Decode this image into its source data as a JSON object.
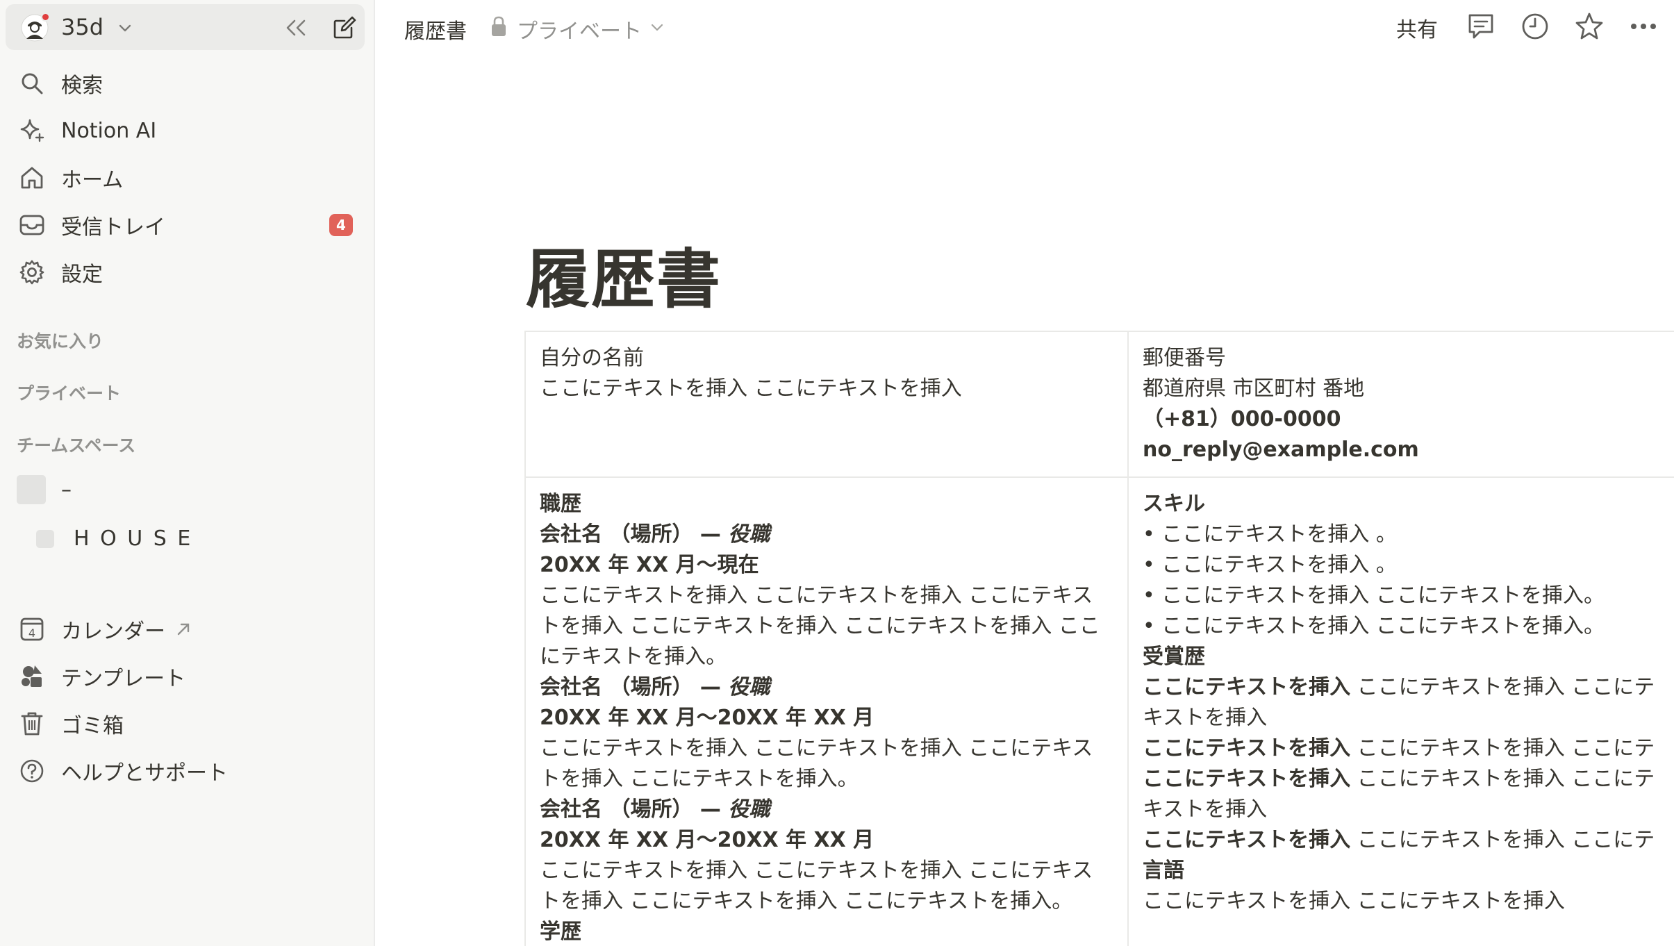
{
  "workspace": {
    "name": "35d"
  },
  "sidebar": {
    "nav": [
      {
        "label": "検索",
        "icon": "search-icon"
      },
      {
        "label": "Notion AI",
        "icon": "sparkle-icon"
      },
      {
        "label": "ホーム",
        "icon": "home-icon"
      },
      {
        "label": "受信トレイ",
        "icon": "inbox-icon",
        "badge": "4"
      },
      {
        "label": "設定",
        "icon": "gear-icon"
      }
    ],
    "sections": {
      "favorites": "お気に入り",
      "private": "プライベート",
      "teamspace": "チームスペース"
    },
    "teamspace_items": [
      {
        "label": "–"
      },
      {
        "label": "H O U S E"
      }
    ],
    "bottom": [
      {
        "label": "カレンダー",
        "icon": "calendar-icon",
        "calendar_day": "4"
      },
      {
        "label": "テンプレート",
        "icon": "templates-icon"
      },
      {
        "label": "ゴミ箱",
        "icon": "trash-icon"
      },
      {
        "label": "ヘルプとサポート",
        "icon": "help-icon"
      }
    ]
  },
  "topbar": {
    "page_title": "履歴書",
    "privacy": "プライベート",
    "share": "共有"
  },
  "page": {
    "title": "履歴書",
    "table": {
      "r1c1": [
        "自分の名前",
        "ここにテキストを挿入 ここにテキストを挿入"
      ],
      "r1c2": [
        "郵便番号",
        "都道府県 市区町村 番地",
        "（+81）000-0000",
        "no_reply@example.com"
      ],
      "work": {
        "heading": "職歴",
        "jobs": [
          {
            "company": "会社名 （場所） — ",
            "role": "役職",
            "period": "20XX 年 XX 月〜現在",
            "desc": [
              "ここにテキストを挿入 ここにテキストを挿入 ここにテキス",
              "トを挿入 ここにテキストを挿入 ここにテキストを挿入 ここ",
              "にテキストを挿入。"
            ]
          },
          {
            "company": "会社名 （場所） — ",
            "role": "役職",
            "period": "20XX 年 XX 月〜20XX 年 XX 月",
            "desc": [
              "ここにテキストを挿入 ここにテキストを挿入 ここにテキス",
              "トを挿入 ここにテキストを挿入。"
            ]
          },
          {
            "company": "会社名 （場所） — ",
            "role": "役職",
            "period": "20XX 年 XX 月〜20XX 年 XX 月",
            "desc": [
              "ここにテキストを挿入 ここにテキストを挿入 ここにテキス",
              "トを挿入 ここにテキストを挿入 ここにテキストを挿入。"
            ]
          }
        ],
        "education": "学歴"
      },
      "skills": {
        "heading": "スキル",
        "items": [
          "• ここにテキストを挿入 。",
          "• ここにテキストを挿入 。",
          "• ここにテキストを挿入 ここにテキストを挿入。",
          "• ここにテキストを挿入 ここにテキストを挿入。"
        ],
        "awards_heading": "受賞歴",
        "awards": [
          {
            "bold": "ここにテキストを挿入",
            "rest": " ここにテキストを挿入 ここにテ"
          },
          {
            "bold": "",
            "rest": "キストを挿入"
          },
          {
            "bold": "ここにテキストを挿入",
            "rest": " ここにテキストを挿入 ここにテ"
          },
          {
            "bold": "ここにテキストを挿入",
            "rest": " ここにテキストを挿入 ここにテ"
          },
          {
            "bold": "",
            "rest": "キストを挿入"
          },
          {
            "bold": "ここにテキストを挿入",
            "rest": " ここにテキストを挿入 ここにテ"
          }
        ],
        "language_heading": "言語",
        "language": "ここにテキストを挿入 ここにテキストを挿入"
      }
    }
  }
}
